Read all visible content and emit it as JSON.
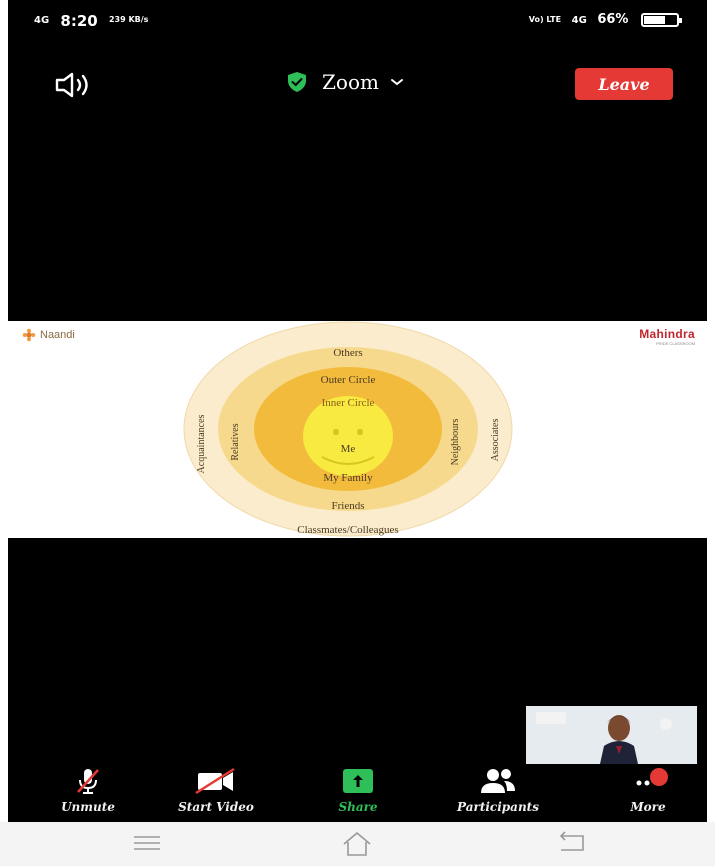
{
  "status_bar": {
    "network": "4G",
    "time": "8:20",
    "speed": "239 KB/s",
    "volte": "Vo) LTE",
    "network_right": "4G",
    "battery": "66%",
    "battery_level": 0.66
  },
  "header": {
    "title": "Zoom",
    "leave_label": "Leave",
    "colors": {
      "leave": "#e53935",
      "shield": "#2fbf58"
    }
  },
  "shared_slide": {
    "left_brand": "Naandi",
    "right_brand": "Mahindra",
    "right_brand_sub": "PRIDE CLASSROOM",
    "rings": [
      {
        "label": "Others",
        "color": "#fbeccd"
      },
      {
        "label": "Outer Circle",
        "color": "#f6d98c"
      },
      {
        "label": "Inner Circle",
        "color": "#f3bb3c"
      },
      {
        "label": "Me",
        "color": "#f8ea40"
      }
    ],
    "labels": {
      "others": "Others",
      "outer_circle": "Outer Circle",
      "inner_circle": "Inner Circle",
      "me": "Me",
      "my_family": "My Family",
      "friends": "Friends",
      "classmates": "Classmates/Colleagues",
      "acquaintances": "Acquaintances",
      "relatives": "Relatives",
      "neighbours": "Neighbours",
      "associates": "Associates"
    }
  },
  "toolbar": {
    "items": [
      {
        "label": "Unmute",
        "icon": "muted-mic-icon"
      },
      {
        "label": "Start Video",
        "icon": "video-off-icon"
      },
      {
        "label": "Share",
        "icon": "share-arrow-icon"
      },
      {
        "label": "Participants",
        "icon": "participants-icon"
      },
      {
        "label": "More",
        "icon": "more-dots-icon"
      }
    ]
  },
  "nav_bar": {
    "icons": [
      "menu-icon",
      "home-icon",
      "back-icon"
    ]
  }
}
